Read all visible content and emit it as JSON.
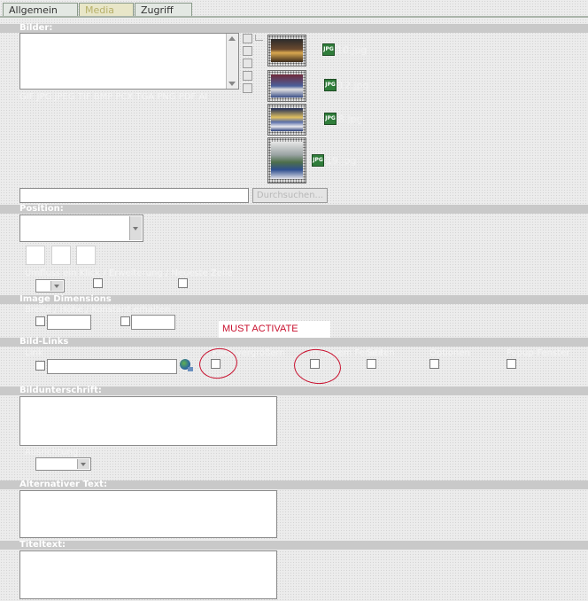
{
  "tabs": [
    {
      "label": "Allgemein"
    },
    {
      "label": "Media"
    },
    {
      "label": "Zugriff"
    }
  ],
  "bilder": {
    "header": "Bilder:",
    "allowed_types": "GIF JPG JPEG TIF BMP PCX TGA PNG PDF AI",
    "file_input_value": "",
    "browse_label": "Durchsuchen...",
    "files": [
      {
        "name": "10.jpg",
        "icon": "jpg-file-icon"
      },
      {
        "name": "12.jpg",
        "icon": "jpg-file-icon"
      },
      {
        "name": "8.jpg",
        "icon": "jpg-file-icon"
      },
      {
        "name": "19.jpg",
        "icon": "jpg-file-icon"
      }
    ]
  },
  "position": {
    "header": "Position:",
    "options_label": "Umfluss ein Klick / Erweiterung / Neueste Zeile",
    "new_row_label": "Neue Zeile"
  },
  "image_dimensions": {
    "header": "Image Dimensions",
    "sublabel": "Breite / Höhe / Konstant erhalten"
  },
  "bild_links": {
    "header": "Bild-Links",
    "url_label": "Link",
    "checkbox_labels": [
      "Klick-vergrößern",
      "In neuem Fenster",
      "Seiten",
      "Optionen",
      "Popup-Fenster"
    ],
    "annotation": "MUST ACTIVATE"
  },
  "bildunterschrift": {
    "header": "Bildunterschrift:",
    "align_label": "Ausrichtung:"
  },
  "alternativer_text": {
    "header": "Alternativer Text:"
  },
  "titeltext": {
    "header": "Titeltext:"
  },
  "colors": {
    "section_header": "#c9c9c9",
    "annotation_red": "#c8102e",
    "file_icon_green": "#2f7d3a"
  }
}
